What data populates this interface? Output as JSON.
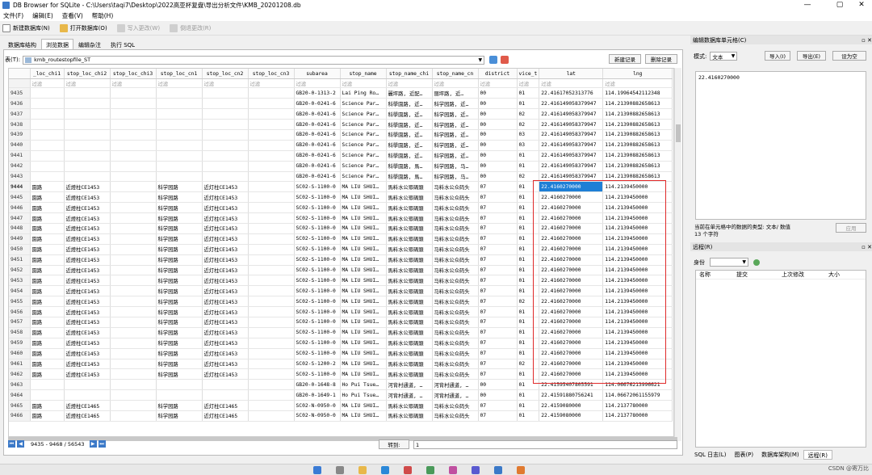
{
  "window": {
    "title": "DB Browser for SQLite - C:\\Users\\taqi7\\Desktop\\2022高亚杯复盘\\导出分析文件\\KMB_20201208.db",
    "min": "—",
    "max": "▢",
    "close": "✕"
  },
  "menu": [
    "文件(F)",
    "编辑(E)",
    "查看(V)",
    "帮助(H)"
  ],
  "toolbar": {
    "new_db": "新建数据库(N)",
    "open_db": "打开数据库(O)",
    "write": "写入更改(W)",
    "revert": "倒退更改(R)"
  },
  "tabs": [
    "数据库结构",
    "浏览数据",
    "编辑杂注",
    "执行 SQL"
  ],
  "table_selector": {
    "label": "表(T):",
    "value": "kmb_routestopfile_ST",
    "new_record": "新建记录",
    "delete_record": "删除记录"
  },
  "columns": [
    "_loc_chi1",
    "stop_loc_chi2",
    "stop_loc_chi3",
    "stop_loc_cn1",
    "stop_loc_cn2",
    "stop_loc_cn3",
    "subarea",
    "stop_name",
    "stop_name_chi",
    "stop_name_cn",
    "district",
    "vice_t",
    "lat",
    "lng"
  ],
  "filter_placeholder": "过滤",
  "rows": [
    [
      "9435",
      "",
      "",
      "",
      "",
      "",
      "",
      "GB20-0-1313-2",
      "Lai Ping Ro…",
      "麗坪路, 近配…",
      "丽坪路, 近…",
      "00",
      "01",
      "22.41617052313776",
      "114.19964542112348"
    ],
    [
      "9436",
      "",
      "",
      "",
      "",
      "",
      "",
      "GB20-0-0241-6",
      "Science Par…",
      "科學園路, 近…",
      "科学园路, 近…",
      "00",
      "01",
      "22.416149058379947",
      "114.21390882658613"
    ],
    [
      "9437",
      "",
      "",
      "",
      "",
      "",
      "",
      "GB20-0-0241-6",
      "Science Par…",
      "科學園路, 近…",
      "科学园路, 近…",
      "00",
      "02",
      "22.416149058379947",
      "114.21390882658613"
    ],
    [
      "9438",
      "",
      "",
      "",
      "",
      "",
      "",
      "GB20-0-0241-6",
      "Science Par…",
      "科學園路, 近…",
      "科学园路, 近…",
      "00",
      "02",
      "22.416149058379947",
      "114.21390882658613"
    ],
    [
      "9439",
      "",
      "",
      "",
      "",
      "",
      "",
      "GB20-0-0241-6",
      "Science Par…",
      "科學園路, 近…",
      "科学园路, 近…",
      "00",
      "03",
      "22.416149058379947",
      "114.21390882658613"
    ],
    [
      "9440",
      "",
      "",
      "",
      "",
      "",
      "",
      "GB20-0-0241-6",
      "Science Par…",
      "科學園路, 近…",
      "科学园路, 近…",
      "00",
      "03",
      "22.416149058379947",
      "114.21390882658613"
    ],
    [
      "9441",
      "",
      "",
      "",
      "",
      "",
      "",
      "GB20-0-0241-6",
      "Science Par…",
      "科學園路, 近…",
      "科学园路, 近…",
      "00",
      "01",
      "22.416149058379947",
      "114.21390882658613"
    ],
    [
      "9442",
      "",
      "",
      "",
      "",
      "",
      "",
      "GB20-0-0241-6",
      "Science Par…",
      "科學園路, 馬…",
      "科学园路, 马…",
      "00",
      "01",
      "22.416149058379947",
      "114.21390882658613"
    ],
    [
      "9443",
      "",
      "",
      "",
      "",
      "",
      "",
      "GB20-0-0241-6",
      "Science Par…",
      "科學園路, 馬…",
      "科学园路, 马…",
      "00",
      "02",
      "22.416149058379947",
      "114.21390882658613"
    ],
    [
      "9444",
      "園路",
      "近燈柱CE1453",
      "",
      "科学园路",
      "近灯柱CE1453",
      "",
      "SC02-S-1100-0",
      "MA LIU SHUI…",
      "馬料水公眾碼頭",
      "马料水公众码头",
      "07",
      "01",
      "22.4160270000",
      "114.2139450000"
    ],
    [
      "9445",
      "園路",
      "近燈柱CE1453",
      "",
      "科学园路",
      "近灯柱CE1453",
      "",
      "SC02-S-1100-0",
      "MA LIU SHUI…",
      "馬料水公眾碼頭",
      "马料水公众码头",
      "07",
      "01",
      "22.4160270000",
      "114.2139450000"
    ],
    [
      "9446",
      "園路",
      "近燈柱CE1453",
      "",
      "科学园路",
      "近灯柱CE1453",
      "",
      "SC02-S-1100-0",
      "MA LIU SHUI…",
      "馬料水公眾碼頭",
      "马料水公众码头",
      "07",
      "01",
      "22.4160270000",
      "114.2139450000"
    ],
    [
      "9447",
      "園路",
      "近燈柱CE1453",
      "",
      "科学园路",
      "近灯柱CE1453",
      "",
      "SC02-S-1100-0",
      "MA LIU SHUI…",
      "馬料水公眾碼頭",
      "马料水公众码头",
      "07",
      "01",
      "22.4160270000",
      "114.2139450000"
    ],
    [
      "9448",
      "園路",
      "近燈柱CE1453",
      "",
      "科学园路",
      "近灯柱CE1453",
      "",
      "SC02-S-1100-0",
      "MA LIU SHUI…",
      "馬料水公眾碼頭",
      "马料水公众码头",
      "07",
      "01",
      "22.4160270000",
      "114.2139450000"
    ],
    [
      "9449",
      "園路",
      "近燈柱CE1453",
      "",
      "科学园路",
      "近灯柱CE1453",
      "",
      "SC02-S-1100-0",
      "MA LIU SHUI…",
      "馬料水公眾碼頭",
      "马料水公众码头",
      "07",
      "01",
      "22.4160270000",
      "114.2139450000"
    ],
    [
      "9450",
      "園路",
      "近燈柱CE1453",
      "",
      "科学园路",
      "近灯柱CE1453",
      "",
      "SC02-S-1100-0",
      "MA LIU SHUI…",
      "馬料水公眾碼頭",
      "马料水公众码头",
      "07",
      "01",
      "22.4160270000",
      "114.2139450000"
    ],
    [
      "9451",
      "園路",
      "近燈柱CE1453",
      "",
      "科学园路",
      "近灯柱CE1453",
      "",
      "SC02-S-1100-0",
      "MA LIU SHUI…",
      "馬料水公眾碼頭",
      "马料水公众码头",
      "07",
      "01",
      "22.4160270000",
      "114.2139450000"
    ],
    [
      "9452",
      "園路",
      "近燈柱CE1453",
      "",
      "科学园路",
      "近灯柱CE1453",
      "",
      "SC02-S-1100-0",
      "MA LIU SHUI…",
      "馬料水公眾碼頭",
      "马料水公众码头",
      "07",
      "01",
      "22.4160270000",
      "114.2139450000"
    ],
    [
      "9453",
      "園路",
      "近燈柱CE1453",
      "",
      "科学园路",
      "近灯柱CE1453",
      "",
      "SC02-S-1100-0",
      "MA LIU SHUI…",
      "馬料水公眾碼頭",
      "马料水公众码头",
      "07",
      "01",
      "22.4160270000",
      "114.2139450000"
    ],
    [
      "9454",
      "園路",
      "近燈柱CE1453",
      "",
      "科学园路",
      "近灯柱CE1453",
      "",
      "SC02-S-1100-0",
      "MA LIU SHUI…",
      "馬料水公眾碼頭",
      "马料水公众码头",
      "07",
      "01",
      "22.4160270000",
      "114.2139450000"
    ],
    [
      "9455",
      "園路",
      "近燈柱CE1453",
      "",
      "科学园路",
      "近灯柱CE1453",
      "",
      "SC02-S-1100-0",
      "MA LIU SHUI…",
      "馬料水公眾碼頭",
      "马料水公众码头",
      "07",
      "02",
      "22.4160270000",
      "114.2139450000"
    ],
    [
      "9456",
      "園路",
      "近燈柱CE1453",
      "",
      "科学园路",
      "近灯柱CE1453",
      "",
      "SC02-S-1100-0",
      "MA LIU SHUI…",
      "馬料水公眾碼頭",
      "马料水公众码头",
      "07",
      "01",
      "22.4160270000",
      "114.2139450000"
    ],
    [
      "9457",
      "園路",
      "近燈柱CE1453",
      "",
      "科学园路",
      "近灯柱CE1453",
      "",
      "SC02-S-1100-0",
      "MA LIU SHUI…",
      "馬料水公眾碼頭",
      "马料水公众码头",
      "07",
      "01",
      "22.4160270000",
      "114.2139450000"
    ],
    [
      "9458",
      "園路",
      "近燈柱CE1453",
      "",
      "科学园路",
      "近灯柱CE1453",
      "",
      "SC02-S-1100-0",
      "MA LIU SHUI…",
      "馬料水公眾碼頭",
      "马料水公众码头",
      "07",
      "01",
      "22.4160270000",
      "114.2139450000"
    ],
    [
      "9459",
      "園路",
      "近燈柱CE1453",
      "",
      "科学园路",
      "近灯柱CE1453",
      "",
      "SC02-S-1100-0",
      "MA LIU SHUI…",
      "馬料水公眾碼頭",
      "马料水公众码头",
      "07",
      "01",
      "22.4160270000",
      "114.2139450000"
    ],
    [
      "9460",
      "園路",
      "近燈柱CE1453",
      "",
      "科学园路",
      "近灯柱CE1453",
      "",
      "SC02-S-1100-0",
      "MA LIU SHUI…",
      "馬料水公眾碼頭",
      "马料水公众码头",
      "07",
      "01",
      "22.4160270000",
      "114.2139450000"
    ],
    [
      "9461",
      "園路",
      "近燈柱CE1453",
      "",
      "科学园路",
      "近灯柱CE1453",
      "",
      "SC02-S-1200-2",
      "MA LIU SHUI…",
      "馬料水公眾碼頭",
      "马料水公众码头",
      "07",
      "02",
      "22.4160270000",
      "114.2139450000"
    ],
    [
      "9462",
      "園路",
      "近燈柱CE1453",
      "",
      "科学园路",
      "近灯柱CE1453",
      "",
      "SC02-S-1100-0",
      "MA LIU SHUI…",
      "馬料水公眾碼頭",
      "马料水公众码头",
      "07",
      "01",
      "22.4160270000",
      "114.2139450000"
    ],
    [
      "9463",
      "",
      "",
      "",
      "",
      "",
      "",
      "GB20-0-1648-8",
      "Ho Pui Tsue…",
      "河背村通道, …",
      "河背村通道, …",
      "00",
      "01",
      "22.41595407805591",
      "114.06676213996621"
    ],
    [
      "9464",
      "",
      "",
      "",
      "",
      "",
      "",
      "GB20-0-1649-1",
      "Ho Pui Tsue…",
      "河背村通道, …",
      "河背村通道, …",
      "00",
      "01",
      "22.41591880756241",
      "114.06672061155979"
    ],
    [
      "9465",
      "園路",
      "近燈柱CE1465",
      "",
      "科学园路",
      "近灯柱CE1465",
      "",
      "SC02-N-0950-0",
      "MA LIU SHUI…",
      "馬料水公眾碼頭",
      "马料水公众码头",
      "07",
      "01",
      "22.4159080000",
      "114.2137780000"
    ],
    [
      "9466",
      "園路",
      "近燈柱CE1465",
      "",
      "科学园路",
      "近灯柱CE1465",
      "",
      "SC02-N-0950-0",
      "MA LIU SHUI…",
      "馬料水公眾碼頭",
      "马料水公众码头",
      "07",
      "01",
      "22.4159080000",
      "114.2137780000"
    ]
  ],
  "selected_row": "9444",
  "navigation": {
    "range": "9435 - 9468 / 56543",
    "goto_label": "转到:",
    "goto_value": "1"
  },
  "cell_editor": {
    "title": "编辑数据库单元格(C)",
    "mode_label": "模式:",
    "mode_value": "文本",
    "import": "导入(I)",
    "export": "导出(E)",
    "set_null": "设为空",
    "content": "22.4160270000",
    "type_info": "当前在单元格中的数据的类型: 文本/ 数值",
    "size_info": "13 个字符",
    "apply": "应用"
  },
  "remote": {
    "title": "远程(R)",
    "identity_label": "身份",
    "cols": [
      "名称",
      "提交",
      "上次修改",
      "大小"
    ]
  },
  "bottom_tabs": [
    "SQL 日志(L)",
    "图表(P)",
    "数据库架构(M)",
    "远程(R)"
  ],
  "watermark": "CSDN @寄万比"
}
